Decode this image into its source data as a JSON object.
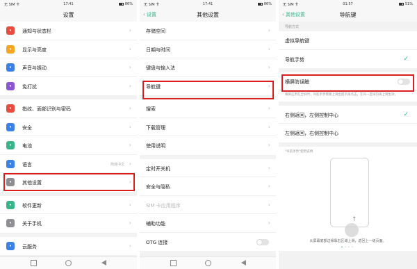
{
  "screen1": {
    "status": {
      "carrier": "无 SIM 卡",
      "time": "17:41",
      "battery": "86%"
    },
    "title": "设置",
    "groups": [
      [
        {
          "label": "通知与状态栏",
          "icon": "bell-icon",
          "color": "#e94b3c"
        },
        {
          "label": "显示与亮度",
          "icon": "brightness-icon",
          "color": "#f5a623"
        },
        {
          "label": "声音与振动",
          "icon": "speaker-icon",
          "color": "#3b82e6"
        },
        {
          "label": "免打扰",
          "icon": "moon-icon",
          "color": "#8a56d6"
        }
      ],
      [
        {
          "label": "指纹、面部识别与密码",
          "icon": "fingerprint-icon",
          "color": "#e94b3c"
        },
        {
          "label": "安全",
          "icon": "shield-icon",
          "color": "#3b82e6"
        },
        {
          "label": "电池",
          "icon": "battery-icon",
          "color": "#38b48b"
        },
        {
          "label": "语言",
          "icon": "language-icon",
          "color": "#3b82e6",
          "value": "简体中文"
        },
        {
          "label": "其他设置",
          "icon": "gear-icon",
          "color": "#8e8e93"
        }
      ],
      [
        {
          "label": "软件更新",
          "icon": "update-icon",
          "color": "#38b48b"
        },
        {
          "label": "关于手机",
          "icon": "info-icon",
          "color": "#8e8e93"
        }
      ],
      [
        {
          "label": "云服务",
          "icon": "cloud-icon",
          "color": "#3b82e6"
        }
      ]
    ]
  },
  "screen2": {
    "status": {
      "carrier": "无 SIM 卡",
      "time": "17:41",
      "battery": "86%"
    },
    "back": "设置",
    "title": "其他设置",
    "groups": [
      [
        {
          "label": "存储空间"
        },
        {
          "label": "日期与时间"
        },
        {
          "label": "键盘与输入法"
        },
        {
          "label": "导航键"
        }
      ],
      [
        {
          "label": "搜索"
        },
        {
          "label": "下载管理"
        },
        {
          "label": "使用说明"
        }
      ],
      [
        {
          "label": "定时开关机"
        },
        {
          "label": "安全与隐私"
        },
        {
          "label": "SIM 卡应用程序",
          "dim": true
        },
        {
          "label": "辅助功能"
        },
        {
          "label": "OTG 连接",
          "toggle": true
        }
      ]
    ]
  },
  "screen3": {
    "status": {
      "carrier": "无 SIM 卡",
      "time": "01:57",
      "battery": "51%"
    },
    "back": "其他设置",
    "title": "导航键",
    "section_label": "导航方式",
    "nav_options": [
      {
        "label": "虚拟导航键",
        "checked": false
      },
      {
        "label": "导航手势",
        "checked": true
      }
    ],
    "anti_mistouch": {
      "label": "横屏防误触",
      "on": false,
      "desc": "横屏应用在全屏时，导航手势需要上滑出提示再点击，在同一区域内再上滑生效。"
    },
    "side_options": [
      {
        "label": "右侧返回，左侧控制中心",
        "checked": true
      },
      {
        "label": "左侧返回，右侧控制中心",
        "checked": false
      }
    ],
    "gesture_caption": "\"导航手势\"使用说明",
    "gesture_text": "从屏幕底部边缘靠右区域上滑，返回上一级页面。"
  }
}
